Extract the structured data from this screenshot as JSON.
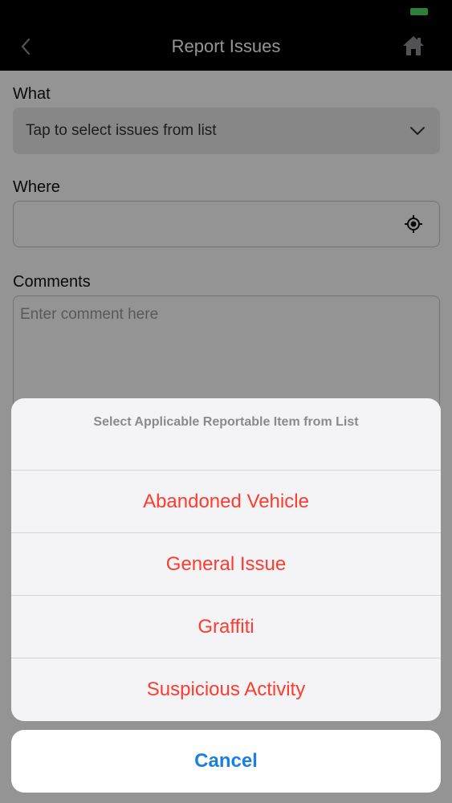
{
  "nav": {
    "title": "Report Issues"
  },
  "form": {
    "what_label": "What",
    "what_placeholder": "Tap to select issues from list",
    "where_label": "Where",
    "comments_label": "Comments",
    "comments_placeholder": "Enter comment here"
  },
  "action_sheet": {
    "title": "Select Applicable Reportable Item from List",
    "items": [
      {
        "label": "Abandoned Vehicle"
      },
      {
        "label": "General Issue"
      },
      {
        "label": "Graffiti"
      },
      {
        "label": "Suspicious Activity"
      }
    ],
    "cancel_label": "Cancel"
  },
  "colors": {
    "destructive_item": "#ff3b30",
    "cancel_text": "#1a7fe0",
    "battery": "#4cd964"
  },
  "icons": {
    "back": "chevron-left-icon",
    "home": "home-icon",
    "dropdown": "chevron-down-icon",
    "location": "location-target-icon"
  }
}
